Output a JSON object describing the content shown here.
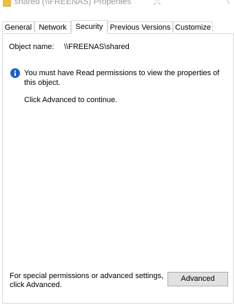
{
  "window": {
    "title": "shared (\\\\FREENAS) Properties",
    "title_icon": "folder-icon"
  },
  "tabs": [
    {
      "label": "General",
      "active": false
    },
    {
      "label": "Network",
      "active": false
    },
    {
      "label": "Security",
      "active": true
    },
    {
      "label": "Previous Versions",
      "active": false
    },
    {
      "label": "Customize",
      "active": false
    }
  ],
  "security": {
    "object_name_label": "Object name:",
    "object_name_value": "\\\\FREENAS\\shared",
    "info_icon": "info-icon",
    "info_message": "You must have Read permissions to view the properties of this object.",
    "click_advanced_text": "Click Advanced to continue.",
    "special_permissions_text": "For special permissions or advanced settings, click Advanced.",
    "advanced_button_label": "Advanced"
  },
  "colors": {
    "info_icon_blue": "#1a62c6",
    "button_bg": "#e1e1e1",
    "button_border": "#adadad",
    "tab_border": "#d9d9d9",
    "title_text": "#9a9a9a"
  }
}
